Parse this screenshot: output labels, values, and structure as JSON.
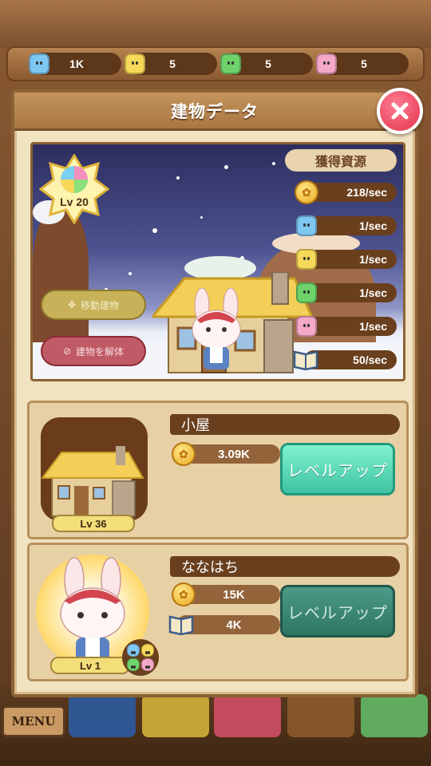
{
  "resources": [
    {
      "icon": "blue-critter-icon",
      "value": "1K"
    },
    {
      "icon": "yellow-critter-icon",
      "value": "5"
    },
    {
      "icon": "green-critter-icon",
      "value": "5"
    },
    {
      "icon": "pink-critter-icon",
      "value": "5"
    }
  ],
  "modal": {
    "title": "建物データ",
    "close_icon": "close-icon"
  },
  "scene": {
    "level": "Lv 20",
    "gain_title": "獲得資源",
    "gains": [
      {
        "icon": "paw-coin-icon",
        "rate": "218/sec"
      },
      {
        "icon": "blue-critter-icon",
        "rate": "1/sec"
      },
      {
        "icon": "yellow-critter-icon",
        "rate": "1/sec"
      },
      {
        "icon": "green-critter-icon",
        "rate": "1/sec"
      },
      {
        "icon": "pink-critter-icon",
        "rate": "1/sec"
      },
      {
        "icon": "book-icon",
        "rate": "50/sec"
      }
    ],
    "move_button": "移動建物",
    "demolish_button": "建物を解体"
  },
  "building": {
    "name": "小屋",
    "level": "Lv 36",
    "cost": "3.09K",
    "levelup_label": "レベルアップ"
  },
  "character": {
    "name": "ななはち",
    "level": "Lv 1",
    "cost_coins": "15K",
    "cost_books": "4K",
    "levelup_label": "レベルアップ"
  },
  "bottom_nav": {
    "menu_label": "MENU"
  },
  "colors": {
    "close": "#e2334f",
    "levelup_active": "#3fc3a2",
    "levelup_disabled": "#2f7564"
  }
}
